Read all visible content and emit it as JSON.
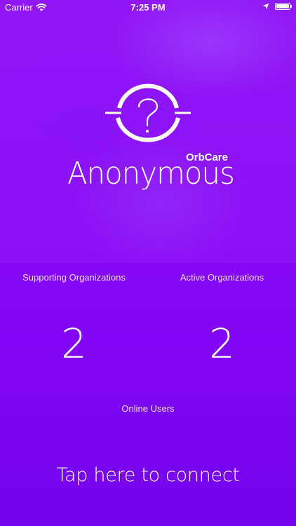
{
  "status_bar": {
    "carrier": "Carrier",
    "time": "7:25 PM"
  },
  "logo": {
    "brand": "OrbCare",
    "name": "Anonymous",
    "icon": "question-orb-icon"
  },
  "stats": {
    "supporting": {
      "label": "Supporting Organizations",
      "value": "2"
    },
    "active": {
      "label": "Active Organizations",
      "value": "2"
    }
  },
  "online": {
    "label": "Online Users"
  },
  "connect": {
    "label": "Tap here to connect"
  },
  "colors": {
    "background": "#8a12f4",
    "text": "#ffffff"
  }
}
